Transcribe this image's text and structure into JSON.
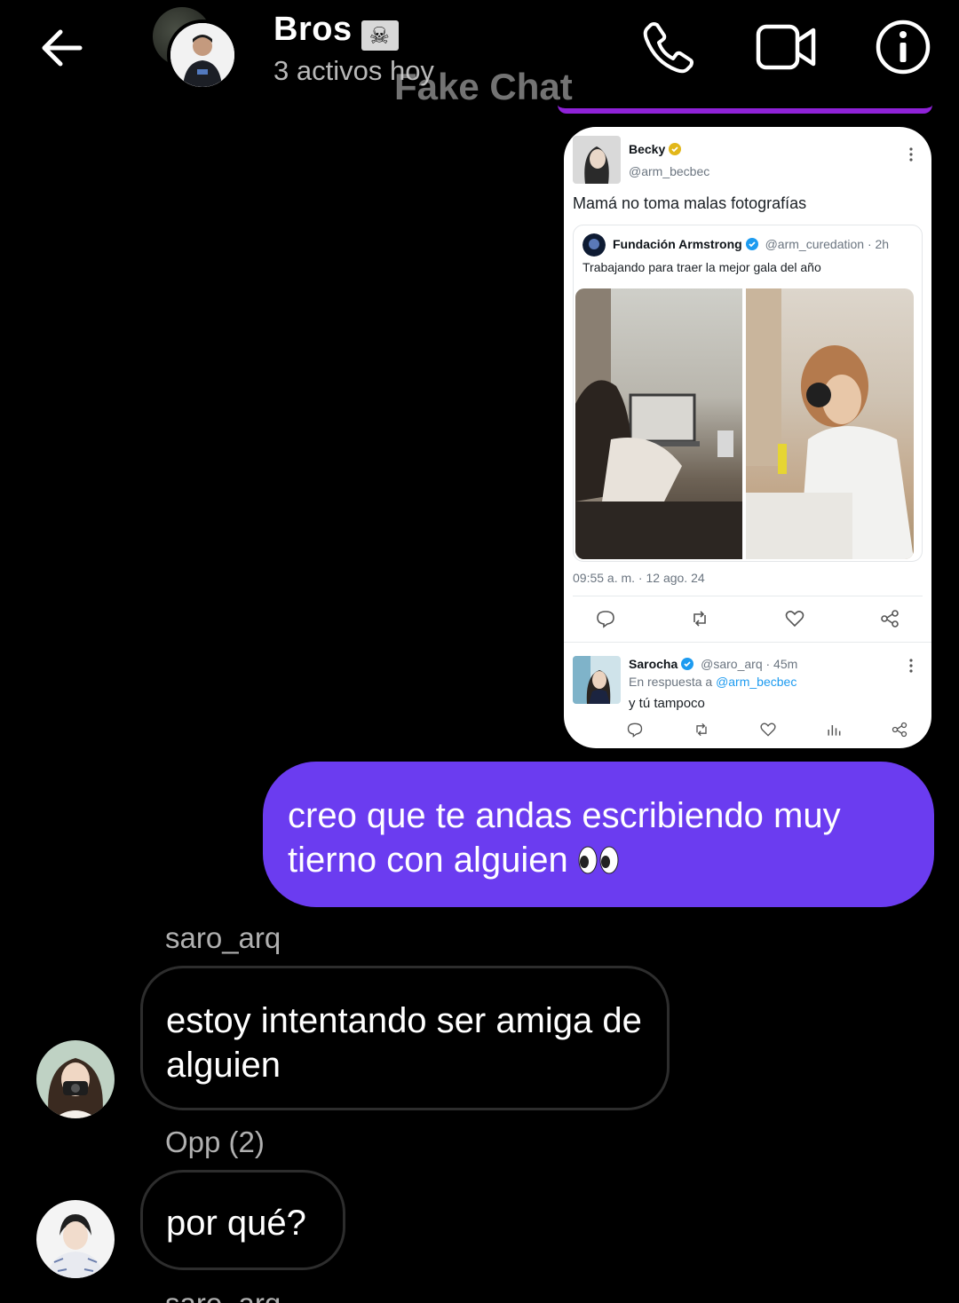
{
  "header": {
    "title": "Bros",
    "flag_icon": "pirate-flag",
    "subtitle": "3 activos hoy",
    "watermark": "Fake Chat",
    "icons": [
      "back-arrow-icon",
      "phone-icon",
      "video-camera-icon",
      "info-icon"
    ]
  },
  "shared_tweet": {
    "author_name": "Becky",
    "author_handle": "@arm_becbec",
    "text": "Mamá no toma malas fotografías",
    "quote": {
      "name": "Fundación Armstrong",
      "handle_time": "@arm_curedation · 2h",
      "text": "Trabajando para traer la mejor gala del año"
    },
    "timestamp": "09:55 a. m. · 12 ago. 24",
    "reply": {
      "name": "Sarocha",
      "handle_time": "@saro_arq · 45m",
      "in_reply_prefix": "En respuesta a",
      "in_reply_handle": "@arm_becbec",
      "text": "y tú tampoco"
    }
  },
  "messages": [
    {
      "direction": "out",
      "text": "creo que te andas escribiendo muy tierno con alguien",
      "emoji": "eyes-emoji"
    },
    {
      "direction": "in",
      "sender": "saro_arq",
      "text": "estoy intentando ser amiga de alguien"
    },
    {
      "direction": "in",
      "sender": "Opp (2)",
      "text": "por qué?"
    },
    {
      "direction": "in",
      "sender": "saro_arq",
      "text": ""
    }
  ],
  "colors": {
    "background": "#000000",
    "outgoing_bubble": "#6b3cf0",
    "accent_line": "#8f22d8",
    "incoming_border": "#2d2d2d",
    "verified_blue": "#1d9bf0",
    "verified_gold": "#e2b719"
  }
}
